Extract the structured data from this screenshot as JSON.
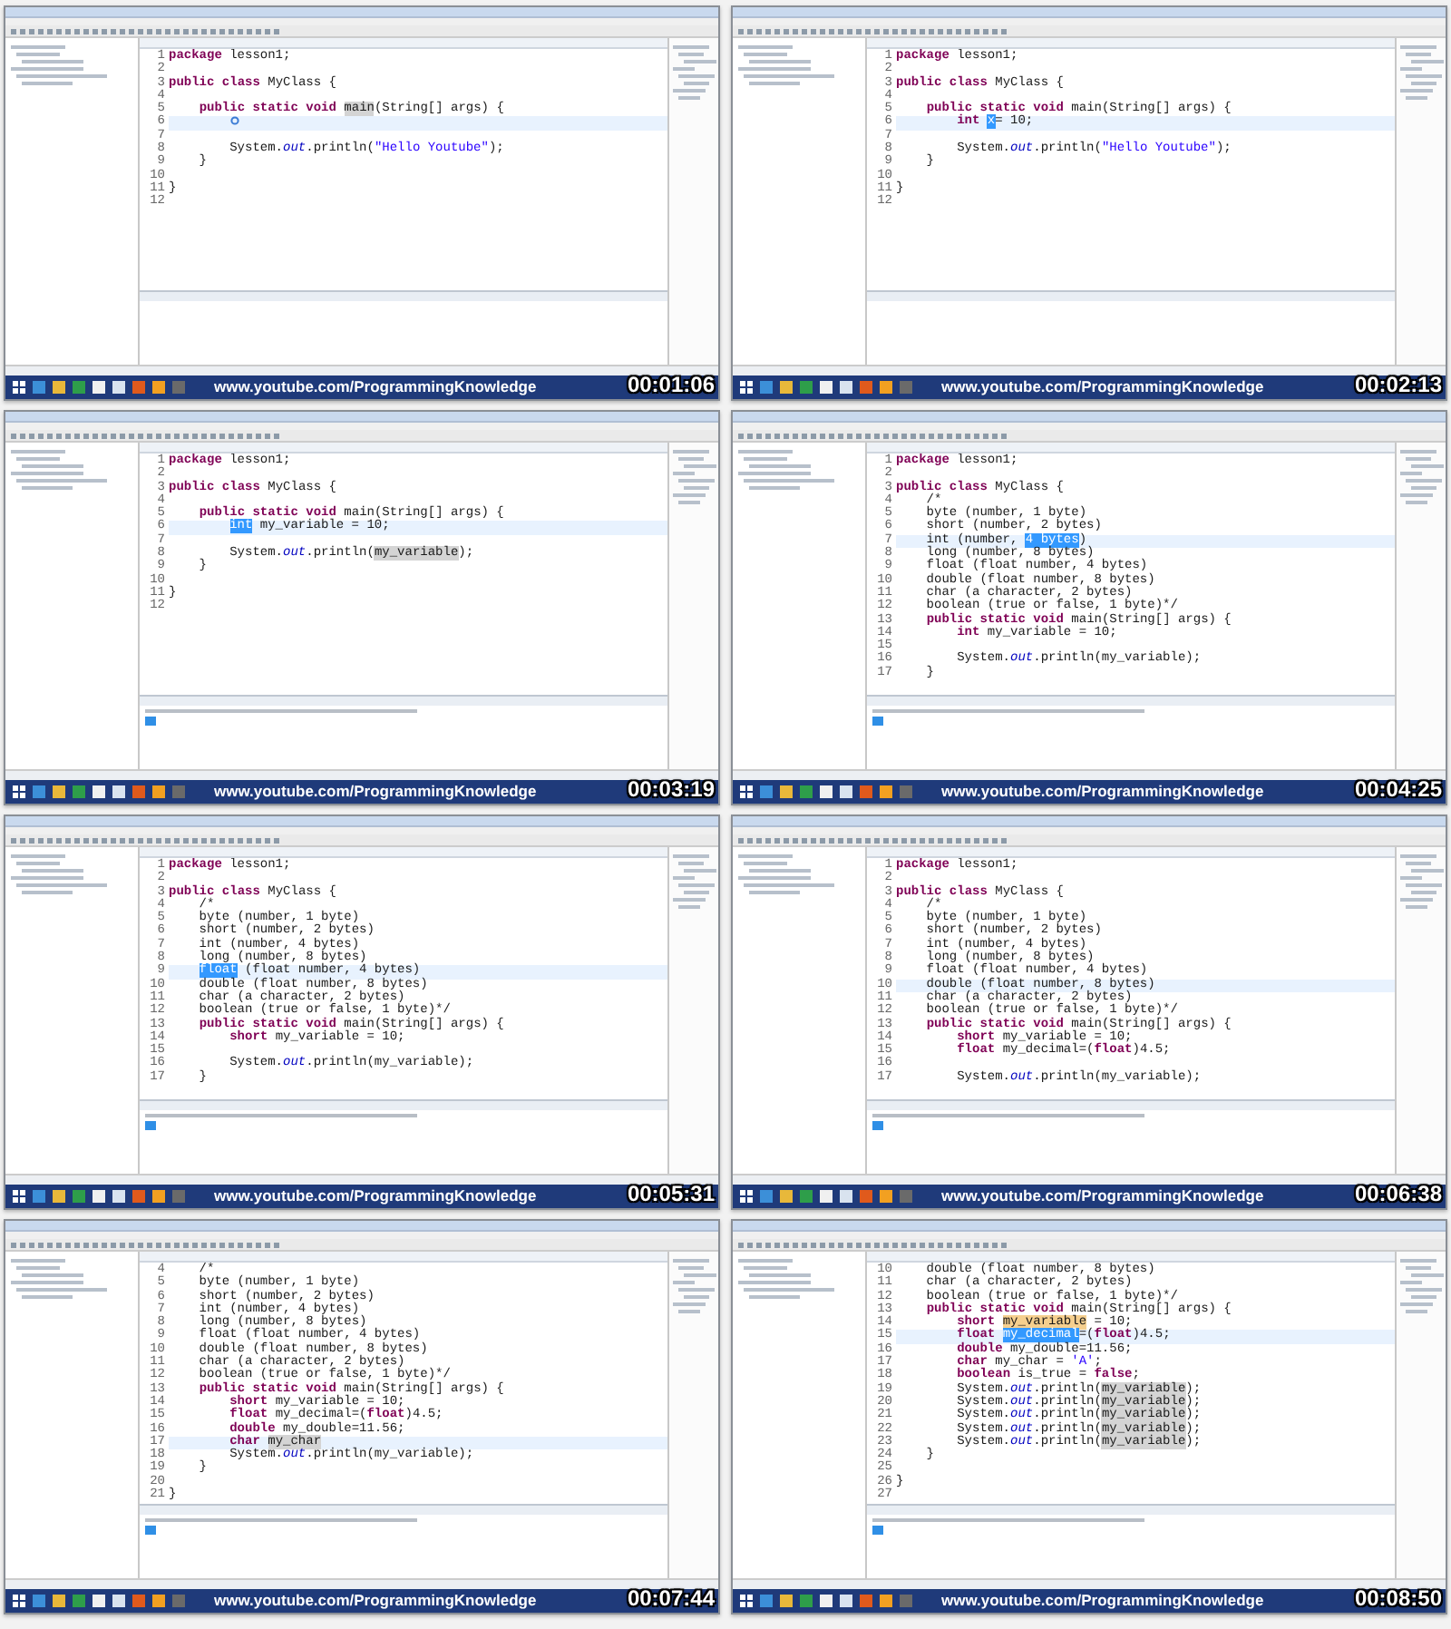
{
  "frames": [
    {
      "timestamp": "00:01:06",
      "url": "www.youtube.com/ProgrammingKnowledge",
      "console_output": false,
      "lines": [
        {
          "num": "1",
          "current": false,
          "parts": [
            {
              "kind": "code",
              "text": "**package** lesson1;"
            }
          ]
        },
        {
          "num": "2",
          "current": false
        },
        {
          "num": "3",
          "current": false,
          "parts": [
            {
              "kind": "code",
              "text": "**public** **class** MyClass {"
            }
          ]
        },
        {
          "num": "4",
          "current": false
        },
        {
          "num": "5",
          "current": false,
          "parts": [
            {
              "kind": "code",
              "text": "    **public** **static** **void** "
            },
            {
              "kind": "occurrence",
              "text": "main"
            },
            {
              "kind": "code",
              "text": "(String[] args) {"
            }
          ]
        },
        {
          "num": "6",
          "current": true,
          "marker": true
        },
        {
          "num": "7",
          "current": false
        },
        {
          "num": "8",
          "current": false,
          "parts": [
            {
              "kind": "code",
              "text": "        System.*out*.println("
            },
            {
              "kind": "string",
              "text": "\"Hello Youtube\""
            },
            {
              "kind": "code",
              "text": ");"
            }
          ]
        },
        {
          "num": "9",
          "current": false,
          "parts": [
            {
              "kind": "code",
              "text": "    }"
            }
          ]
        },
        {
          "num": "10",
          "current": false
        },
        {
          "num": "11",
          "current": false,
          "parts": [
            {
              "kind": "code",
              "text": "}"
            }
          ]
        },
        {
          "num": "12",
          "current": false
        }
      ]
    },
    {
      "timestamp": "00:02:13",
      "url": "www.youtube.com/ProgrammingKnowledge",
      "console_output": false,
      "lines": [
        {
          "num": "1",
          "current": false,
          "parts": [
            {
              "kind": "code",
              "text": "**package** lesson1;"
            }
          ]
        },
        {
          "num": "2",
          "current": false
        },
        {
          "num": "3",
          "current": false,
          "parts": [
            {
              "kind": "code",
              "text": "**public** **class** MyClass {"
            }
          ]
        },
        {
          "num": "4",
          "current": false
        },
        {
          "num": "5",
          "current": false,
          "parts": [
            {
              "kind": "code",
              "text": "    **public** **static** **void** main(String[] args) {"
            }
          ]
        },
        {
          "num": "6",
          "current": true,
          "parts": [
            {
              "kind": "code",
              "text": "        **int** "
            },
            {
              "kind": "selection",
              "text": "x"
            },
            {
              "kind": "code",
              "text": "= 10;"
            }
          ]
        },
        {
          "num": "7",
          "current": false
        },
        {
          "num": "8",
          "current": false,
          "parts": [
            {
              "kind": "code",
              "text": "        System.*out*.println("
            },
            {
              "kind": "string",
              "text": "\"Hello Youtube\""
            },
            {
              "kind": "code",
              "text": ");"
            }
          ]
        },
        {
          "num": "9",
          "current": false,
          "parts": [
            {
              "kind": "code",
              "text": "    }"
            }
          ]
        },
        {
          "num": "10",
          "current": false
        },
        {
          "num": "11",
          "current": false,
          "parts": [
            {
              "kind": "code",
              "text": "}"
            }
          ]
        },
        {
          "num": "12",
          "current": false
        }
      ]
    },
    {
      "timestamp": "00:03:19",
      "url": "www.youtube.com/ProgrammingKnowledge",
      "console_output": true,
      "lines": [
        {
          "num": "1",
          "current": false,
          "parts": [
            {
              "kind": "code",
              "text": "**package** lesson1;"
            }
          ]
        },
        {
          "num": "2",
          "current": false
        },
        {
          "num": "3",
          "current": false,
          "parts": [
            {
              "kind": "code",
              "text": "**public** **class** MyClass {"
            }
          ]
        },
        {
          "num": "4",
          "current": false
        },
        {
          "num": "5",
          "current": false,
          "parts": [
            {
              "kind": "code",
              "text": "    **public** **static** **void** main(String[] args) {"
            }
          ]
        },
        {
          "num": "6",
          "current": true,
          "kind": "nested",
          "parts": [
            {
              "kind": "selection",
              "text": "int"
            },
            {
              "kind": "code",
              "text": " my_variable = 10;"
            }
          ]
        },
        {
          "num": "7",
          "current": false
        },
        {
          "num": "8",
          "current": false,
          "parts": [
            {
              "kind": "code",
              "text": "        System.*out*.println("
            },
            {
              "kind": "occurrence",
              "text": "my_variable"
            },
            {
              "kind": "code",
              "text": ");"
            }
          ]
        },
        {
          "num": "9",
          "current": false,
          "parts": [
            {
              "kind": "code",
              "text": "    }"
            }
          ]
        },
        {
          "num": "10",
          "current": false
        },
        {
          "num": "11",
          "current": false,
          "parts": [
            {
              "kind": "code",
              "text": "}"
            }
          ]
        },
        {
          "num": "12",
          "current": false
        }
      ]
    },
    {
      "timestamp": "00:04:25",
      "url": "www.youtube.com/ProgrammingKnowledge",
      "console_output": true,
      "lines": [
        {
          "num": "1",
          "current": false,
          "parts": [
            {
              "kind": "code",
              "text": "**package** lesson1;"
            }
          ]
        },
        {
          "num": "2",
          "current": false
        },
        {
          "num": "3",
          "current": false,
          "parts": [
            {
              "kind": "code",
              "text": "**public** **class** MyClass {"
            }
          ]
        },
        {
          "num": "4",
          "current": false,
          "parts": [
            {
              "kind": "code",
              "text": "    /*"
            }
          ]
        },
        {
          "num": "5",
          "current": false,
          "parts": [
            {
              "kind": "code",
              "text": "    byte (number, 1 byte)"
            }
          ]
        },
        {
          "num": "6",
          "current": false,
          "parts": [
            {
              "kind": "code",
              "text": "    short (number, 2 bytes)"
            }
          ]
        },
        {
          "num": "7",
          "current": true,
          "parts": [
            {
              "kind": "code",
              "text": "    int (number, "
            },
            {
              "kind": "selection",
              "text": "4 bytes"
            },
            {
              "kind": "code",
              "text": ")"
            }
          ]
        },
        {
          "num": "8",
          "current": false,
          "parts": [
            {
              "kind": "code",
              "text": "    long (number, 8 bytes)"
            }
          ]
        },
        {
          "num": "9",
          "current": false,
          "parts": [
            {
              "kind": "code",
              "text": "    float (float number, 4 bytes)"
            }
          ]
        },
        {
          "num": "10",
          "current": false,
          "parts": [
            {
              "kind": "code",
              "text": "    double (float number, 8 bytes)"
            }
          ]
        },
        {
          "num": "11",
          "current": false,
          "parts": [
            {
              "kind": "code",
              "text": "    char (a character, 2 bytes)"
            }
          ]
        },
        {
          "num": "12",
          "current": false,
          "parts": [
            {
              "kind": "code",
              "text": "    boolean (true or false, 1 byte)*/"
            }
          ]
        },
        {
          "num": "13",
          "current": false,
          "parts": [
            {
              "kind": "code",
              "text": "    **public** **static** **void** main(String[] args) {"
            }
          ]
        },
        {
          "num": "14",
          "current": false,
          "parts": [
            {
              "kind": "code",
              "text": "        **int** my_variable = 10;"
            }
          ]
        },
        {
          "num": "15",
          "current": false
        },
        {
          "num": "16",
          "current": false,
          "parts": [
            {
              "kind": "code",
              "text": "        System.*out*.println(my_variable);"
            }
          ]
        },
        {
          "num": "17",
          "current": false,
          "parts": [
            {
              "kind": "code",
              "text": "    }"
            }
          ]
        }
      ]
    },
    {
      "timestamp": "00:05:31",
      "url": "www.youtube.com/ProgrammingKnowledge",
      "console_output": true,
      "lines": [
        {
          "num": "1",
          "current": false,
          "parts": [
            {
              "kind": "code",
              "text": "**package** lesson1;"
            }
          ]
        },
        {
          "num": "2",
          "current": false
        },
        {
          "num": "3",
          "current": false,
          "parts": [
            {
              "kind": "code",
              "text": "**public** **class** MyClass {"
            }
          ]
        },
        {
          "num": "4",
          "current": false,
          "parts": [
            {
              "kind": "code",
              "text": "    /*"
            }
          ]
        },
        {
          "num": "5",
          "current": false,
          "parts": [
            {
              "kind": "code",
              "text": "    byte (number, 1 byte)"
            }
          ]
        },
        {
          "num": "6",
          "current": false,
          "parts": [
            {
              "kind": "code",
              "text": "    short (number, 2 bytes)"
            }
          ]
        },
        {
          "num": "7",
          "current": false,
          "parts": [
            {
              "kind": "code",
              "text": "    int (number, 4 bytes)"
            }
          ]
        },
        {
          "num": "8",
          "current": false,
          "parts": [
            {
              "kind": "code",
              "text": "    long (number, 8 bytes)"
            }
          ]
        },
        {
          "num": "9",
          "current": true,
          "kind": "member",
          "parts": [
            {
              "kind": "selection",
              "text": "float"
            },
            {
              "kind": "code",
              "text": " (float number, 4 bytes)"
            }
          ]
        },
        {
          "num": "10",
          "current": false,
          "parts": [
            {
              "kind": "code",
              "text": "    double (float number, 8 bytes)"
            }
          ]
        },
        {
          "num": "11",
          "current": false,
          "parts": [
            {
              "kind": "code",
              "text": "    char (a character, 2 bytes)"
            }
          ]
        },
        {
          "num": "12",
          "current": false,
          "parts": [
            {
              "kind": "code",
              "text": "    boolean (true or false, 1 byte)*/"
            }
          ]
        },
        {
          "num": "13",
          "current": false,
          "parts": [
            {
              "kind": "code",
              "text": "    **public** **static** **void** main(String[] args) {"
            }
          ]
        },
        {
          "num": "14",
          "current": false,
          "parts": [
            {
              "kind": "code",
              "text": "        **short** my_variable = 10;"
            }
          ]
        },
        {
          "num": "15",
          "current": false
        },
        {
          "num": "16",
          "current": false,
          "parts": [
            {
              "kind": "code",
              "text": "        System.*out*.println(my_variable);"
            }
          ]
        },
        {
          "num": "17",
          "current": false,
          "parts": [
            {
              "kind": "code",
              "text": "    }"
            }
          ]
        }
      ]
    },
    {
      "timestamp": "00:06:38",
      "url": "www.youtube.com/ProgrammingKnowledge",
      "console_output": true,
      "lines": [
        {
          "num": "1",
          "current": false,
          "parts": [
            {
              "kind": "code",
              "text": "**package** lesson1;"
            }
          ]
        },
        {
          "num": "2",
          "current": false
        },
        {
          "num": "3",
          "current": false,
          "parts": [
            {
              "kind": "code",
              "text": "**public** **class** MyClass {"
            }
          ]
        },
        {
          "num": "4",
          "current": false,
          "parts": [
            {
              "kind": "code",
              "text": "    /*"
            }
          ]
        },
        {
          "num": "5",
          "current": false,
          "parts": [
            {
              "kind": "code",
              "text": "    byte (number, 1 byte)"
            }
          ]
        },
        {
          "num": "6",
          "current": false,
          "parts": [
            {
              "kind": "code",
              "text": "    short (number, 2 bytes)"
            }
          ]
        },
        {
          "num": "7",
          "current": false,
          "parts": [
            {
              "kind": "code",
              "text": "    int (number, 4 bytes)"
            }
          ]
        },
        {
          "num": "8",
          "current": false,
          "parts": [
            {
              "kind": "code",
              "text": "    long (number, 8 bytes)"
            }
          ]
        },
        {
          "num": "9",
          "current": false,
          "parts": [
            {
              "kind": "code",
              "text": "    float (float number, 4 bytes)"
            }
          ]
        },
        {
          "num": "10",
          "current": true,
          "parts": [
            {
              "kind": "code",
              "text": "    double (float number, 8 bytes)"
            }
          ]
        },
        {
          "num": "11",
          "current": false,
          "parts": [
            {
              "kind": "code",
              "text": "    char (a character, 2 bytes)"
            }
          ]
        },
        {
          "num": "12",
          "current": false,
          "parts": [
            {
              "kind": "code",
              "text": "    boolean (true or false, 1 byte)*/"
            }
          ]
        },
        {
          "num": "13",
          "current": false,
          "parts": [
            {
              "kind": "code",
              "text": "    **public** **static** **void** main(String[] args) {"
            }
          ]
        },
        {
          "num": "14",
          "current": false,
          "parts": [
            {
              "kind": "code",
              "text": "        **short** my_variable = 10;"
            }
          ]
        },
        {
          "num": "15",
          "current": false,
          "parts": [
            {
              "kind": "code",
              "text": "        **float** my_decimal=(**float**)4.5;"
            }
          ]
        },
        {
          "num": "16",
          "current": false
        },
        {
          "num": "17",
          "current": false,
          "parts": [
            {
              "kind": "code",
              "text": "        System.*out*.println(my_variable);"
            }
          ]
        }
      ]
    },
    {
      "timestamp": "00:07:44",
      "url": "www.youtube.com/ProgrammingKnowledge",
      "console_output": true,
      "lines": [
        {
          "num": "4",
          "current": false,
          "parts": [
            {
              "kind": "code",
              "text": "    /*"
            }
          ]
        },
        {
          "num": "5",
          "current": false,
          "parts": [
            {
              "kind": "code",
              "text": "    byte (number, 1 byte)"
            }
          ]
        },
        {
          "num": "6",
          "current": false,
          "parts": [
            {
              "kind": "code",
              "text": "    short (number, 2 bytes)"
            }
          ]
        },
        {
          "num": "7",
          "current": false,
          "parts": [
            {
              "kind": "code",
              "text": "    int (number, 4 bytes)"
            }
          ]
        },
        {
          "num": "8",
          "current": false,
          "parts": [
            {
              "kind": "code",
              "text": "    long (number, 8 bytes)"
            }
          ]
        },
        {
          "num": "9",
          "current": false,
          "parts": [
            {
              "kind": "code",
              "text": "    float (float number, 4 bytes)"
            }
          ]
        },
        {
          "num": "10",
          "current": false,
          "parts": [
            {
              "kind": "code",
              "text": "    double (float number, 8 bytes)"
            }
          ]
        },
        {
          "num": "11",
          "current": false,
          "parts": [
            {
              "kind": "code",
              "text": "    char (a character, 2 bytes)"
            }
          ]
        },
        {
          "num": "12",
          "current": false,
          "parts": [
            {
              "kind": "code",
              "text": "    boolean (true or false, 1 byte)*/"
            }
          ]
        },
        {
          "num": "13",
          "current": false,
          "parts": [
            {
              "kind": "code",
              "text": "    **public** **static** **void** main(String[] args) {"
            }
          ]
        },
        {
          "num": "14",
          "current": false,
          "parts": [
            {
              "kind": "code",
              "text": "        **short** my_variable = 10;"
            }
          ]
        },
        {
          "num": "15",
          "current": false,
          "parts": [
            {
              "kind": "code",
              "text": "        **float** my_decimal=(**float**)4.5;"
            }
          ]
        },
        {
          "num": "16",
          "current": false,
          "parts": [
            {
              "kind": "code",
              "text": "        **double** my_double=11.56;"
            }
          ]
        },
        {
          "num": "17",
          "current": true,
          "parts": [
            {
              "kind": "code",
              "text": "        **char** "
            },
            {
              "kind": "occurrence",
              "text": "my_char"
            }
          ]
        },
        {
          "num": "18",
          "current": false,
          "parts": [
            {
              "kind": "code",
              "text": "        System.*out*.println(my_variable);"
            }
          ]
        },
        {
          "num": "19",
          "current": false,
          "parts": [
            {
              "kind": "code",
              "text": "    }"
            }
          ]
        },
        {
          "num": "20",
          "current": false
        },
        {
          "num": "21",
          "current": false,
          "parts": [
            {
              "kind": "code",
              "text": "}"
            }
          ]
        }
      ]
    },
    {
      "timestamp": "00:08:50",
      "url": "www.youtube.com/ProgrammingKnowledge",
      "console_output": true,
      "lines": [
        {
          "num": "10",
          "current": false,
          "parts": [
            {
              "kind": "code",
              "text": "    double (float number, 8 bytes)"
            }
          ]
        },
        {
          "num": "11",
          "current": false,
          "parts": [
            {
              "kind": "code",
              "text": "    char (a character, 2 bytes)"
            }
          ]
        },
        {
          "num": "12",
          "current": false,
          "parts": [
            {
              "kind": "code",
              "text": "    boolean (true or false, 1 byte)*/"
            }
          ]
        },
        {
          "num": "13",
          "current": false,
          "parts": [
            {
              "kind": "code",
              "text": "    **public** **static** **void** main(String[] args) {"
            }
          ]
        },
        {
          "num": "14",
          "current": false,
          "parts": [
            {
              "kind": "code",
              "text": "        **short** "
            },
            {
              "kind": "write",
              "text": "my_variable"
            },
            {
              "kind": "code",
              "text": " = 10;"
            }
          ]
        },
        {
          "num": "15",
          "current": true,
          "parts": [
            {
              "kind": "code",
              "text": "        **float** "
            },
            {
              "kind": "selection",
              "text": "my_decimal"
            },
            {
              "kind": "code",
              "text": "=(**float**)4.5;"
            }
          ]
        },
        {
          "num": "16",
          "current": false,
          "parts": [
            {
              "kind": "code",
              "text": "        **double** my_double=11.56;"
            }
          ]
        },
        {
          "num": "17",
          "current": false,
          "parts": [
            {
              "kind": "code",
              "text": "        **char** my_char = "
            },
            {
              "kind": "string",
              "text": "'A'"
            },
            {
              "kind": "code",
              "text": ";"
            }
          ]
        },
        {
          "num": "18",
          "current": false,
          "parts": [
            {
              "kind": "code",
              "text": "        **boolean** is_true = **false**;"
            }
          ]
        },
        {
          "num": "19",
          "current": false,
          "parts": [
            {
              "kind": "code",
              "text": "        System.*out*.println("
            },
            {
              "kind": "occurrence",
              "text": "my_variable"
            },
            {
              "kind": "code",
              "text": ");"
            }
          ]
        },
        {
          "num": "20",
          "current": false,
          "parts": [
            {
              "kind": "code",
              "text": "        System.*out*.println("
            },
            {
              "kind": "occurrence",
              "text": "my_variable"
            },
            {
              "kind": "code",
              "text": ");"
            }
          ]
        },
        {
          "num": "21",
          "current": false,
          "parts": [
            {
              "kind": "code",
              "text": "        System.*out*.println("
            },
            {
              "kind": "occurrence",
              "text": "my_variable"
            },
            {
              "kind": "code",
              "text": ");"
            }
          ]
        },
        {
          "num": "22",
          "current": false,
          "parts": [
            {
              "kind": "code",
              "text": "        System.*out*.println("
            },
            {
              "kind": "occurrence",
              "text": "my_variable"
            },
            {
              "kind": "code",
              "text": ");"
            }
          ]
        },
        {
          "num": "23",
          "current": false,
          "parts": [
            {
              "kind": "code",
              "text": "        System.*out*.println("
            },
            {
              "kind": "occurrence",
              "text": "my_variable"
            },
            {
              "kind": "code",
              "text": ");"
            }
          ]
        },
        {
          "num": "24",
          "current": false,
          "parts": [
            {
              "kind": "code",
              "text": "    }"
            }
          ]
        },
        {
          "num": "25",
          "current": false
        },
        {
          "num": "26",
          "current": false,
          "parts": [
            {
              "kind": "code",
              "text": "}"
            }
          ]
        },
        {
          "num": "27",
          "current": false
        }
      ]
    }
  ]
}
